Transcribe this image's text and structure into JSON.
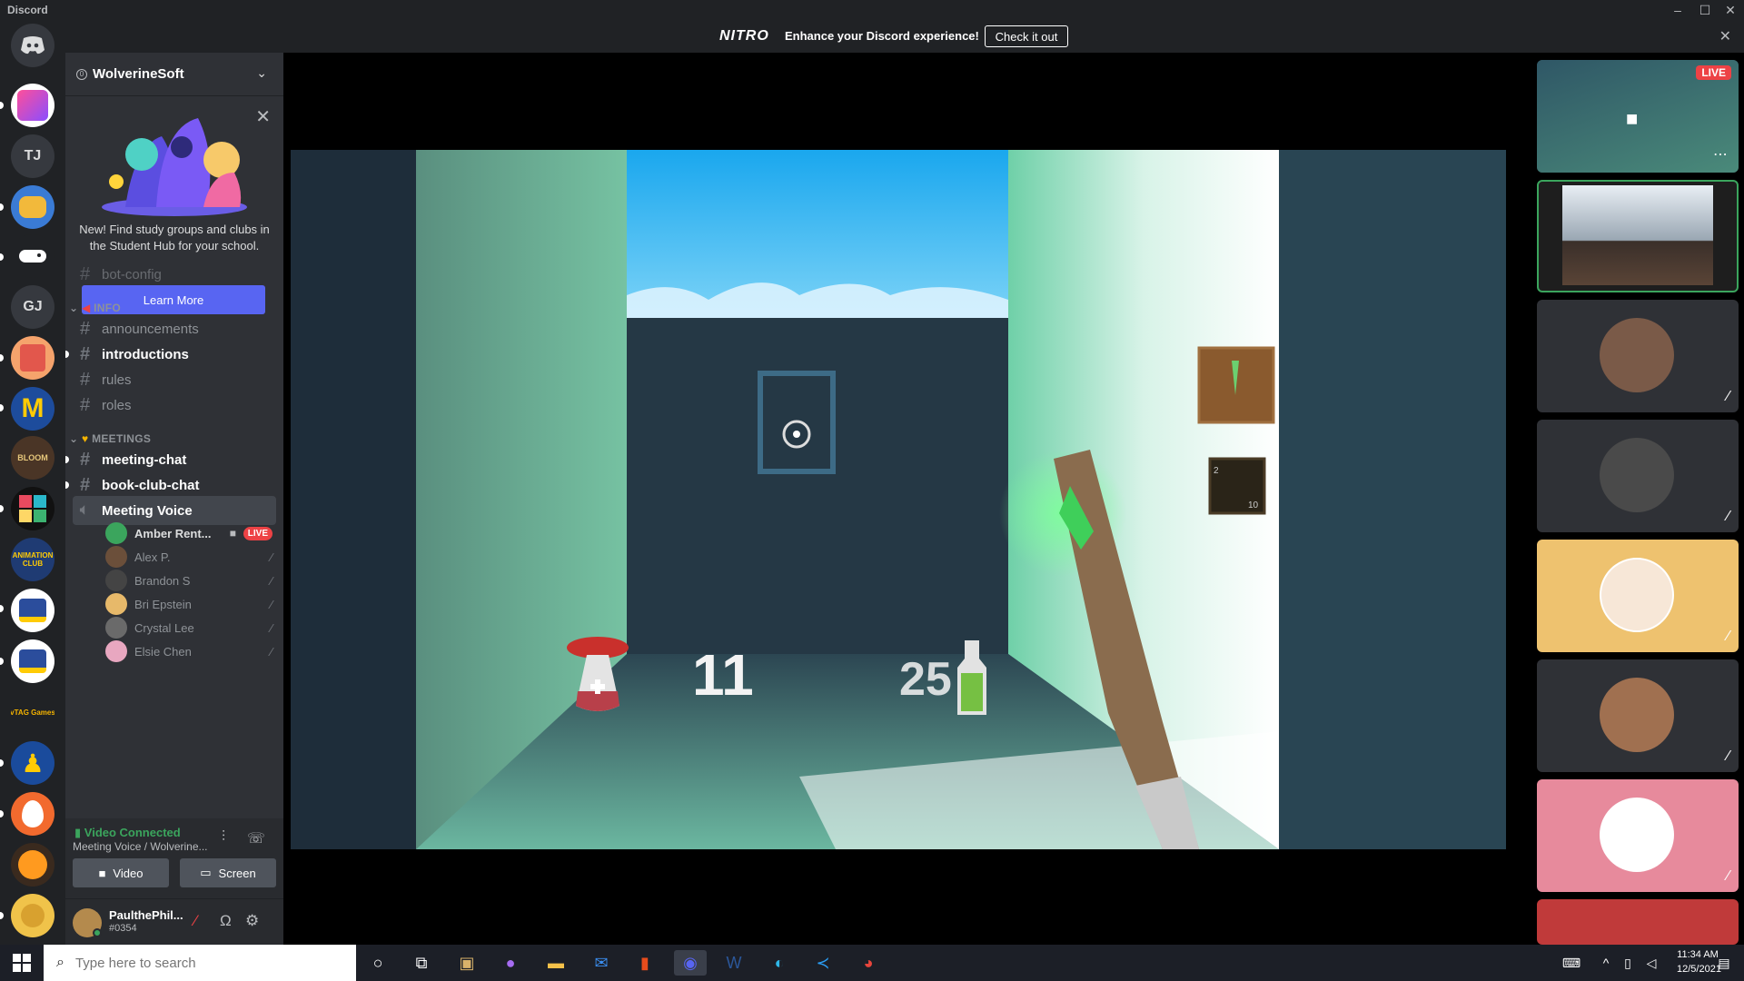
{
  "window": {
    "title": "Discord"
  },
  "nitro": {
    "logo": "NITRO",
    "message": "Enhance your Discord experience!",
    "cta": "Check it out"
  },
  "rail": {
    "text_servers": [
      "TJ",
      "GJ"
    ],
    "tiny_label": "vTAG Games"
  },
  "guild": {
    "name": "WolverineSoft"
  },
  "promo": {
    "text": "New! Find study groups and clubs in the Student Hub for your school.",
    "button": "Learn More"
  },
  "channels": {
    "partial": "bot-config",
    "info_category": "INFO",
    "info": [
      "announcements",
      "introductions",
      "rules",
      "roles"
    ],
    "meetings_category": "MEETINGS",
    "meetings": [
      "meeting-chat",
      "book-club-chat"
    ],
    "voice_channel": "Meeting Voice",
    "voice_users": [
      {
        "name": "Amber Rent...",
        "live": "LIVE"
      },
      {
        "name": "Alex P."
      },
      {
        "name": "Brandon S"
      },
      {
        "name": "Bri Epstein"
      },
      {
        "name": "Crystal Lee"
      },
      {
        "name": "Elsie Chen"
      }
    ]
  },
  "voice_panel": {
    "status": "Video Connected",
    "subtitle": "Meeting Voice / Wolverine...",
    "video_label": "Video",
    "screen_label": "Screen"
  },
  "user": {
    "name": "PaulthePhil...",
    "tag": "#0354"
  },
  "hud": {
    "health": "11",
    "mana": "25",
    "card_top": "2",
    "card_bottom": "10"
  },
  "tiles": {
    "live_label": "LIVE"
  },
  "taskbar": {
    "search_placeholder": "Type here to search",
    "time": "11:34 AM",
    "date": "12/5/2021"
  },
  "colors": {
    "accent": "#5865f2",
    "live": "#ed4245",
    "connected": "#3ba55d"
  }
}
